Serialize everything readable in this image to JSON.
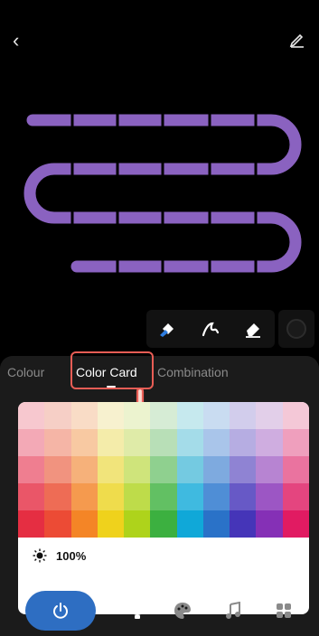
{
  "topbar": {
    "back_icon": "chevron-left-icon",
    "edit_icon": "pencil-icon"
  },
  "strip": {
    "color": "#8a62c0"
  },
  "tools": {
    "items": [
      "paint-bucket-icon",
      "brush-icon",
      "eraser-icon"
    ],
    "record_icon": "record-icon"
  },
  "tabs": {
    "colour": "Colour",
    "color_card": "Color Card",
    "combination": "Combination"
  },
  "brightness": {
    "icon": "sun-icon",
    "value": "100%"
  },
  "palette": [
    [
      "#f7c8cf",
      "#f6cfc6",
      "#f9dcc6",
      "#f7f1cf",
      "#ecf3cf",
      "#d6ecd5",
      "#c6e9ee",
      "#c9dcf1",
      "#d2cdec",
      "#e2cfe9",
      "#f4c8d7"
    ],
    [
      "#f3a9b6",
      "#f5b5a6",
      "#f8c9a2",
      "#f4ecaa",
      "#dfeba8",
      "#b8dfb7",
      "#a4dce9",
      "#a9c5ea",
      "#b6ade2",
      "#cfade0",
      "#ef9fbd"
    ],
    [
      "#ef7e90",
      "#f1937f",
      "#f6b17a",
      "#f1e47b",
      "#cfe47b",
      "#8fd08f",
      "#74cae1",
      "#7eaadf",
      "#8f83d3",
      "#b784d2",
      "#ea739f"
    ],
    [
      "#ea5668",
      "#ee6c55",
      "#f59a4e",
      "#efdc4c",
      "#bedc4a",
      "#62c063",
      "#3fbae0",
      "#4f8ed6",
      "#6759c6",
      "#9c56c4",
      "#e4457f"
    ],
    [
      "#e52e42",
      "#ec4b35",
      "#f48526",
      "#efd21c",
      "#aed31b",
      "#3cb040",
      "#10a8d8",
      "#2a72c8",
      "#4535b8",
      "#8530b6",
      "#e11b62"
    ]
  ],
  "nav": {
    "power_icon": "power-icon",
    "items": [
      "bulb-icon",
      "palette-icon",
      "music-icon",
      "grid-icon"
    ]
  }
}
